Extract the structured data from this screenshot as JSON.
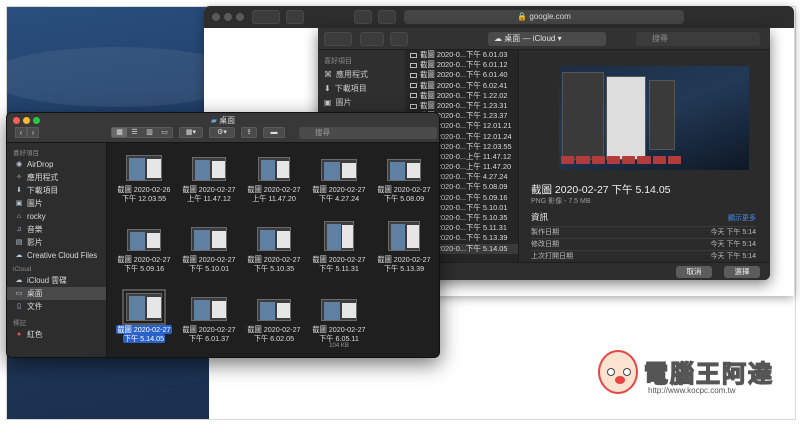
{
  "safari": {
    "url": "google.com"
  },
  "dialog": {
    "location": "桌面 — iCloud",
    "search_placeholder": "搜尋",
    "sidebar_heading": "喜好項目",
    "sidebar": [
      "應用程式",
      "下載項目",
      "圖片"
    ],
    "files": [
      "截圖 2020-0...下午 6.01.03",
      "截圖 2020-0...下午 6.01.12",
      "截圖 2020-0...下午 6.01.40",
      "截圖 2020-0...下午 6.02.41",
      "截圖 2020-0...下午 1.22.02",
      "截圖 2020-0...下午 1.23.31",
      "截圖 2020-0...下午 1.23.37",
      "截圖 2020-0...下午 12.01.21",
      "截圖 2020-0...下午 12.01.24",
      "截圖 2020-0...下午 12.03.55",
      "截圖 2020-0...上午 11.47.12",
      "截圖 2020-0...上午 11.47.20",
      "截圖 2020-0...下午 4.27.24",
      "截圖 2020-0...下午 5.08.09",
      "截圖 2020-0...下午 5.09.16",
      "截圖 2020-0...下午 5.10.01",
      "截圖 2020-0...下午 5.10.35",
      "截圖 2020-0...下午 5.11.31",
      "截圖 2020-0...下午 5.13.39",
      "截圖 2020-0...下午 5.14.05"
    ],
    "preview": {
      "name": "截圖 2020-02-27 下午 5.14.05",
      "kind": "PNG 影像 - 7.5 MB",
      "info_label": "資訊",
      "more_label": "顯示更多",
      "rows": [
        {
          "label": "製作日期",
          "value": "今天 下午 5:14"
        },
        {
          "label": "修改日期",
          "value": "今天 下午 5:14"
        },
        {
          "label": "上次打開日期",
          "value": "今天 下午 5:14"
        }
      ]
    },
    "cancel": "取消",
    "choose": "選擇"
  },
  "finder": {
    "title": "桌面",
    "search_placeholder": "搜尋",
    "sidebar": {
      "favorites_heading": "喜好項目",
      "favorites": [
        "AirDrop",
        "應用程式",
        "下載項目",
        "圖片",
        "rocky",
        "音樂",
        "影片",
        "Creative Cloud Files"
      ],
      "icloud_heading": "iCloud",
      "icloud": [
        "iCloud 雲碟",
        "桌面",
        "文件"
      ],
      "tags_heading": "標記",
      "tags": [
        "紅色"
      ]
    },
    "files": [
      {
        "l1": "截圖 2020-02-26",
        "l2": "下午 12.03.55"
      },
      {
        "l1": "截圖 2020-02-27",
        "l2": "上午 11.47.12"
      },
      {
        "l1": "截圖 2020-02-27",
        "l2": "上午 11.47.20"
      },
      {
        "l1": "截圖 2020-02-27",
        "l2": "下午 4.27.24"
      },
      {
        "l1": "截圖 2020-02-27",
        "l2": "下午 5.08.09"
      },
      {
        "l1": "截圖 2020-02-27",
        "l2": "下午 5.09.16"
      },
      {
        "l1": "截圖 2020-02-27",
        "l2": "下午 5.10.01"
      },
      {
        "l1": "截圖 2020-02-27",
        "l2": "下午 5.10.35"
      },
      {
        "l1": "截圖 2020-02-27",
        "l2": "下午 5.11.31"
      },
      {
        "l1": "截圖 2020-02-27",
        "l2": "下午 5.13.39"
      },
      {
        "l1": "截圖 2020-02-27",
        "l2": "下午 5.14.05"
      },
      {
        "l1": "截圖 2020-02-27",
        "l2": "下午 6.01.37"
      },
      {
        "l1": "截圖 2020-02-27",
        "l2": "下午 6.02.05"
      },
      {
        "l1": "截圖 2020-02-27",
        "l2": "下午 6.05.11",
        "size": "104 KB"
      }
    ]
  },
  "watermark": {
    "brand": "電腦王阿達",
    "url": "http://www.kocpc.com.tw"
  }
}
